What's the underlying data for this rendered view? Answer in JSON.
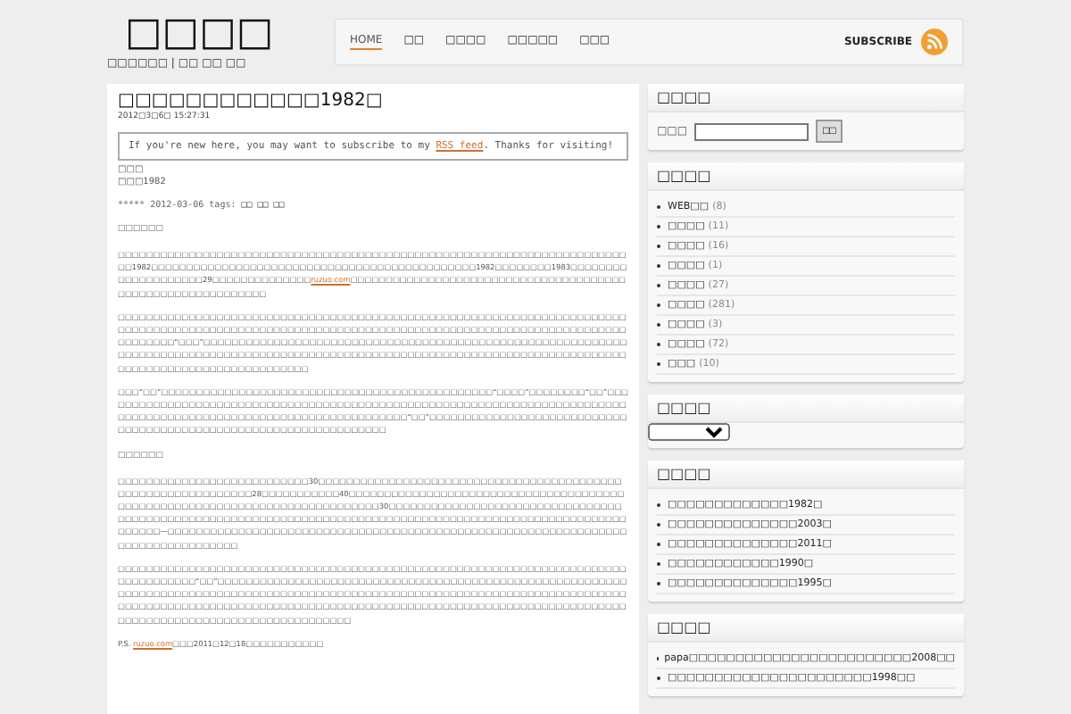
{
  "site": {
    "logo": "□□□□",
    "tagline": "□□□□□□ | □□ □□ □□"
  },
  "nav": {
    "items": [
      {
        "label": "HOME",
        "selected": true
      },
      {
        "label": "□□",
        "selected": false
      },
      {
        "label": "□□□□",
        "selected": false
      },
      {
        "label": "□□□□□",
        "selected": false
      },
      {
        "label": "□□□",
        "selected": false
      }
    ],
    "subscribe": "SUBSCRIBE"
  },
  "post": {
    "title": "□□□□□□□□□□□□1982□",
    "date": "2012□3□6□ 15:27:31",
    "notice": [
      {
        "kind": "text",
        "text": "If you're new here, you may want to subscribe to my "
      },
      {
        "kind": "link",
        "text": "RSS feed"
      },
      {
        "kind": "text",
        "text": ". Thanks for visiting!"
      }
    ],
    "meta_lines": [
      "□□□",
      "□□□1982"
    ],
    "rating": "*****",
    "post_date": "2012-03-06",
    "tags_label": "tags:",
    "tags": [
      "□□",
      "□□",
      "□□"
    ],
    "blocks": [
      {
        "kind": "heading",
        "segments": [
          {
            "kind": "text",
            "text": "□□□□□□"
          }
        ]
      },
      {
        "kind": "para",
        "segments": [
          {
            "kind": "text",
            "text": "□□□□□□□□□□□□□□□□□□□□□□□□□□□□□□□□□□□□□□□□□□□□□□□□□□□□□□□□□□□□□□□□□□□□□□□□□□1982□□□□□□□□□□□□□□□□□□□□□□□□□□□□□□□□□□□□□□□□□□□□□□1982□□□□□□□□1983□□□□□□□□□□□□□□□□□□□□29□□□□□□□□□□□□□□"
          },
          {
            "kind": "link",
            "text": "ruzuo.com"
          },
          {
            "kind": "text",
            "text": "□□□□□□□□□□□□□□□□□□□□□□□□□□□□□□□□□□□□□□□□□□□□□□□□□□□□□□□□□□□□"
          }
        ]
      },
      {
        "kind": "para",
        "segments": [
          {
            "kind": "text",
            "text": "□□□□□□□□□□□□□□□□□□□□□□□□□□□□□□□□□□□□□□□□□□□□□□□□□□□□□□□□□□□□□□□□□□□□□□□□□□□□□□□□□□□□□□□□□□□□□□□□□□□□□□□□□□□□□□□□□□□□□□□□□□□□□□□□□□□□□□□□□□□□□□□□□□□□□□□□“□□□”□□□□□□□□□□□□□□□□□□□□□□□□□□□□□□□□□□□□□□□□□□□□□□□□□□□□□□□□□□□□□□□□□□□□□□□□□□□□□□□□□□□□□□□□□□□□□□□□□□□□□□□□□□□□□□□□□□□□□□□□□□□□□□□□□□□□□□□□□□□□□□□□□□□□□□□□□□□□□□□"
          }
        ]
      },
      {
        "kind": "para",
        "segments": [
          {
            "kind": "text",
            "text": "□□□“□□”□□□□□□□□□□□□□□□□□□□□□□□□□□□□□□□□□□□□□□□□□□□□□□□“□□□□”□□□□□□□□“□□”□□□□□□□□□□□□□□□□□□□□□□□□□□□□□□□□□□□□□□□□□□□□□□□□□□□□□□□□□□□□□□□□□□□□□□□□□□□□□□□□□□□□□□□□□□□□□□□□□□□□□□□□□□□□□□□□□□□□“□□”□□□□□□□□□□□□□□□□□□□□□□□□□□□□□□□□□□□□□□□□□□□□□□□□□□□□□□□□□□□□□□□□□□"
          }
        ]
      },
      {
        "kind": "heading",
        "segments": [
          {
            "kind": "text",
            "text": "□□□□□□"
          }
        ]
      },
      {
        "kind": "para",
        "segments": [
          {
            "kind": "text",
            "text": "□□□□□□□□□□□□□□□□□□□□□□□□□□□30□□□□□□□□□□□□□□□□□□□□□□□□□□□□□□□□□□□□□□□□□□□□□□□□□□□□□□□□□□□□□□28□□□□□□□□□□□40□□□□□□□□□□□□□□□□□□□□□□□□□□□□□□□□□□□□□□□□□□□□□□□□□□□□□□□□□□□□□□□□□□□□□□□□□□□□30□□□□□□□□□□□□□□□□□□□□□□□□□□□□□□□□□□□□□□□□□□□□□□□□□□□□□□□□□□□□□□□□□□□□□□□□□□□□□□□□□□□□□□□□□□□□□□□□□□□□□□□□□□□□□□□—□□□□□□□□□□□□□□□□□□□□□□□□□□□□□□□□□□□□□□□□□□□□□□□□□□□□□□□□□□□□□□□□□□□□□□□□□□□□□□□□□□"
          }
        ]
      },
      {
        "kind": "para",
        "segments": [
          {
            "kind": "text",
            "text": "□□□□□□□□□□□□□□□□□□□□□□□□□□□□□□□□□□□□□□□□□□□□□□□□□□□□□□□□□□□□□□□□□□□□□□□□□□□□□□□□□□□“□□”□□□□□□□□□□□□□□□□□□□□□□□□□□□□□□□□□□□□□□□□□□□□□□□□□□□□□□□□□□□□□□□□□□□□□□□□□□□□□□□□□□□□□□□□□□□□□□□□□□□□□□□□□□□□□□□□□□□□□□□□□□□□□□□□□□□□□□□□□□□□□□□□□□□□□□□□□□□□□□□□□□□□□□□□□□□□□□□□□□□□□□□□□□□□□□□□□□□□□□□□□□□□□□□□□□□□□□□□□□□□□□□□□□□□□□□□□□□"
          }
        ]
      },
      {
        "kind": "para",
        "segments": [
          {
            "kind": "text",
            "text": "P.S. "
          },
          {
            "kind": "link",
            "text": "ruzuo.com"
          },
          {
            "kind": "text",
            "text": "□□□2011□12□18□□□□□□□□□□□"
          }
        ]
      }
    ]
  },
  "sidebar": {
    "widgets": [
      {
        "kind": "search",
        "title": "□□□□",
        "label": "□□□",
        "button": "□□"
      },
      {
        "kind": "list",
        "title": "□□□□",
        "items": [
          {
            "text": "WEB□□",
            "count": "(8)"
          },
          {
            "text": "□□□□",
            "count": "(11)"
          },
          {
            "text": "□□□□",
            "count": "(16)"
          },
          {
            "text": "□□□□",
            "count": "(1)"
          },
          {
            "text": "□□□□",
            "count": "(27)"
          },
          {
            "text": "□□□□",
            "count": "(281)"
          },
          {
            "text": "□□□□",
            "count": "(3)"
          },
          {
            "text": "□□□□",
            "count": "(72)"
          },
          {
            "text": "□□□",
            "count": "(10)"
          }
        ]
      },
      {
        "kind": "select",
        "title": "□□□□"
      },
      {
        "kind": "list",
        "title": "□□□□",
        "items": [
          {
            "text": "□□□□□□□□□□□□□1982□"
          },
          {
            "text": "□□□□□□□□□□□□□□2003□"
          },
          {
            "text": "□□□□□□□□□□□□□□2011□"
          },
          {
            "text": "□□□□□□□□□□□□1990□"
          },
          {
            "text": "□□□□□□□□□□□□□□1995□"
          }
        ]
      },
      {
        "kind": "list",
        "title": "□□□□",
        "items": [
          {
            "text": "papa□□□□□□□□□□□□□□□□□□□□□□□□2008□□"
          },
          {
            "text": "□□□□□□□□□□□□□□□□□□□□□□1998□□"
          }
        ]
      }
    ]
  }
}
